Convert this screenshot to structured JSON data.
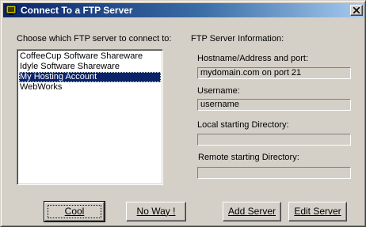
{
  "window": {
    "title": "Connect To a FTP Server"
  },
  "left_panel": {
    "heading": "Choose which FTP server to connect to:",
    "servers": [
      {
        "label": "CoffeeCup Software Shareware",
        "selected": false
      },
      {
        "label": "Idyle Software Shareware",
        "selected": false
      },
      {
        "label": "My Hosting Account",
        "selected": true
      },
      {
        "label": "WebWorks",
        "selected": false
      }
    ]
  },
  "right_panel": {
    "heading": "FTP Server Information:",
    "hostname_label": "Hostname/Address and port:",
    "hostname_value": "mydomain.com on port 21",
    "username_label": "Username:",
    "username_value": "username",
    "local_dir_label": "Local starting Directory:",
    "local_dir_value": "",
    "remote_dir_label": "Remote starting Directory:",
    "remote_dir_value": ""
  },
  "buttons": {
    "cool": "Cool",
    "no_way": "No Way !",
    "add_server": "Add Server",
    "edit_server": "Edit Server"
  },
  "icons": {
    "title": "ftp-app-icon",
    "close": "close-icon"
  }
}
